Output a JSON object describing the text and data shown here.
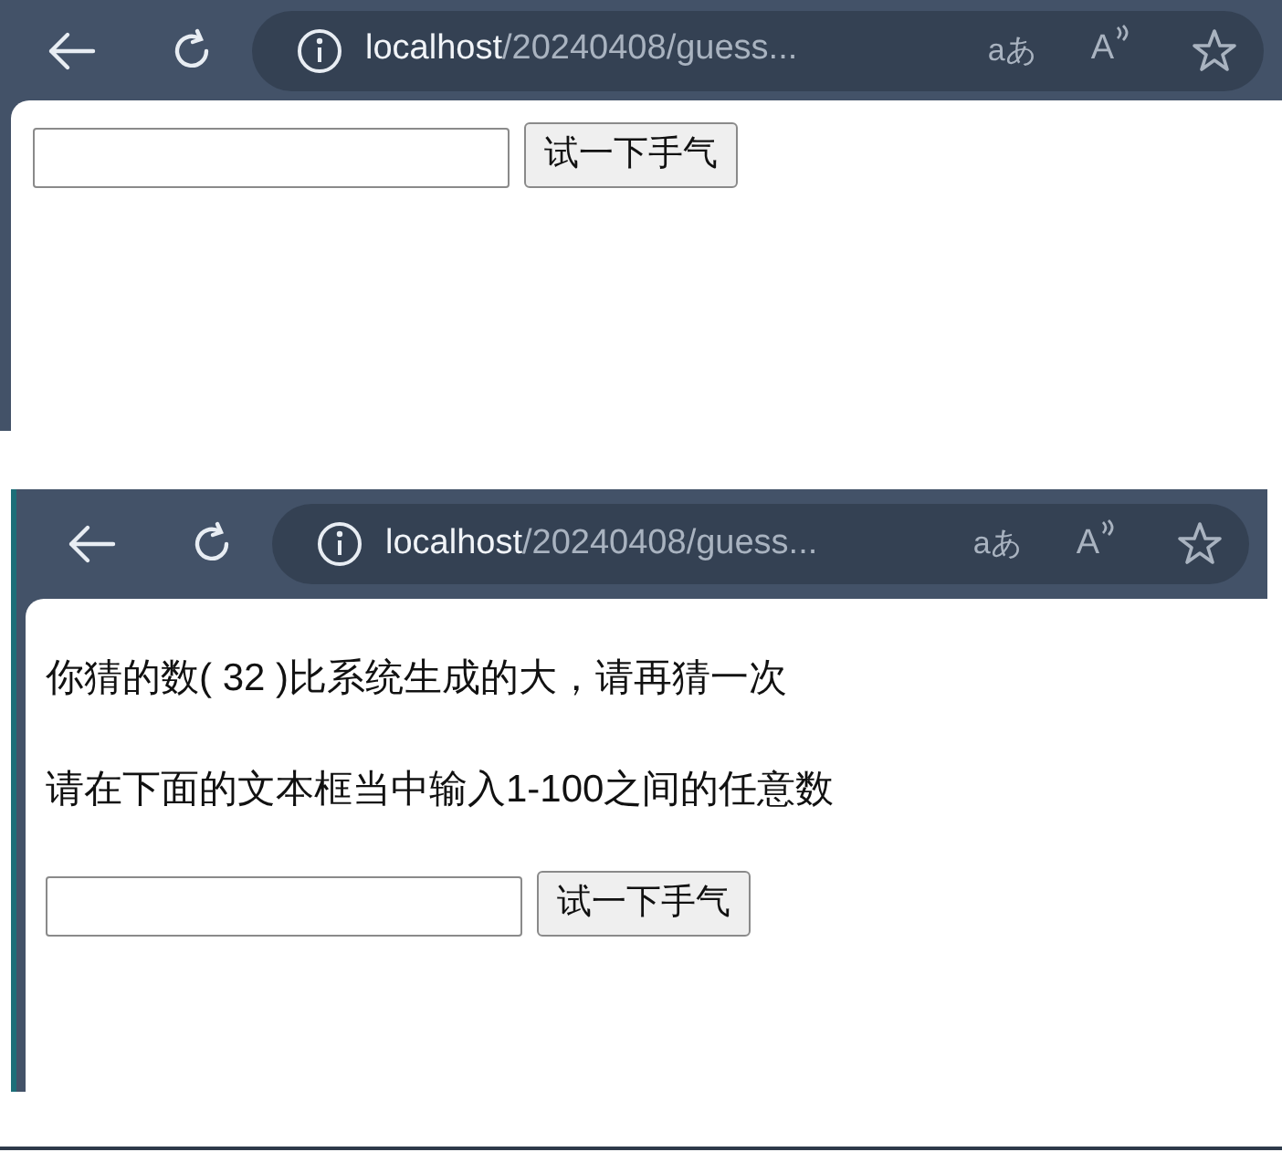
{
  "screenshots": [
    {
      "address": {
        "host": "localhost",
        "path": "/20240408/guess..."
      },
      "translate_glyph": "aあ",
      "read_aloud_glyph": "A",
      "guess_button": "试一下手气"
    },
    {
      "address": {
        "host": "localhost",
        "path": "/20240408/guess..."
      },
      "translate_glyph": "aあ",
      "read_aloud_glyph": "A",
      "messages": [
        "你猜的数( 32 )比系统生成的大，请再猜一次",
        "请在下面的文本框当中输入1-100之间的任意数"
      ],
      "guess_button": "试一下手气"
    }
  ]
}
